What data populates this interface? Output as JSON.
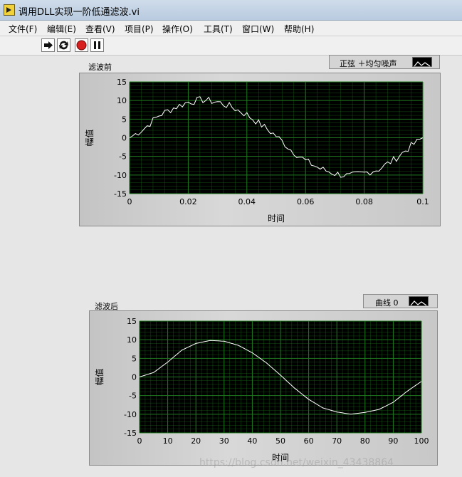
{
  "window": {
    "title": "调用DLL实现一阶低通滤波.vi"
  },
  "menu": [
    "文件(F)",
    "编辑(E)",
    "查看(V)",
    "项目(P)",
    "操作(O)",
    "工具(T)",
    "窗口(W)",
    "帮助(H)"
  ],
  "toolbar": [
    {
      "name": "run-button",
      "icon": "run-arrow-icon"
    },
    {
      "name": "run-continuously-button",
      "icon": "run-continuously-icon"
    },
    {
      "name": "abort-button",
      "icon": "stop-icon"
    },
    {
      "name": "pause-button",
      "icon": "pause-icon"
    }
  ],
  "graph1": {
    "caption": "滤波前",
    "legend_label": "正弦 ＋均匀噪声",
    "chart_data": {
      "type": "line",
      "xlabel": "时间",
      "ylabel": "幅值",
      "xlim": [
        0,
        0.1
      ],
      "ylim": [
        -15,
        15
      ],
      "x_ticks": [
        "0",
        "0.02",
        "0.04",
        "0.06",
        "0.08",
        "0.1"
      ],
      "y_ticks": [
        "15",
        "10",
        "5",
        "0",
        "-5",
        "-10",
        "-15"
      ],
      "grid": true,
      "plot_bg": "#000000",
      "grid_color": "#1f7a1f",
      "line_color": "#ffffff",
      "series": [
        {
          "name": "正弦 ＋均匀噪声",
          "description": "10*sin(2*pi*10*t) with uniform noise, 100 samples over 0..0.1 s",
          "x": [
            0,
            0.005,
            0.01,
            0.015,
            0.02,
            0.025,
            0.03,
            0.035,
            0.04,
            0.045,
            0.05,
            0.055,
            0.06,
            0.065,
            0.07,
            0.075,
            0.08,
            0.085,
            0.09,
            0.095,
            0.1
          ],
          "values": [
            0,
            2.5,
            6.0,
            8.0,
            9.6,
            10.2,
            9.6,
            8.2,
            6.2,
            3.4,
            0.5,
            -3.2,
            -6.2,
            -8.3,
            -9.6,
            -10.3,
            -9.5,
            -8.4,
            -6.0,
            -2.8,
            0
          ]
        }
      ]
    }
  },
  "graph2": {
    "caption": "滤波后",
    "legend_label": "曲线 0",
    "chart_data": {
      "type": "line",
      "xlabel": "时间",
      "ylabel": "幅值",
      "xlim": [
        0,
        100
      ],
      "ylim": [
        -15,
        15
      ],
      "x_ticks": [
        "0",
        "10",
        "20",
        "30",
        "40",
        "50",
        "60",
        "70",
        "80",
        "90",
        "100"
      ],
      "y_ticks": [
        "15",
        "10",
        "5",
        "0",
        "-5",
        "-10",
        "-15"
      ],
      "grid": true,
      "plot_bg": "#000000",
      "grid_color": "#1f7a1f",
      "line_color": "#ffffff",
      "series": [
        {
          "name": "曲线 0",
          "x": [
            0,
            5,
            10,
            15,
            20,
            25,
            30,
            35,
            40,
            45,
            50,
            55,
            60,
            65,
            70,
            75,
            80,
            85,
            90,
            95,
            100
          ],
          "values": [
            0,
            1.2,
            4.0,
            7.2,
            9.0,
            9.8,
            9.6,
            8.5,
            6.5,
            3.8,
            0.5,
            -3.0,
            -6.0,
            -8.3,
            -9.4,
            -10.0,
            -9.5,
            -8.7,
            -6.8,
            -3.8,
            -1.2
          ]
        }
      ]
    }
  },
  "watermark": "https://blog.csdn.net/weixin_43438864"
}
